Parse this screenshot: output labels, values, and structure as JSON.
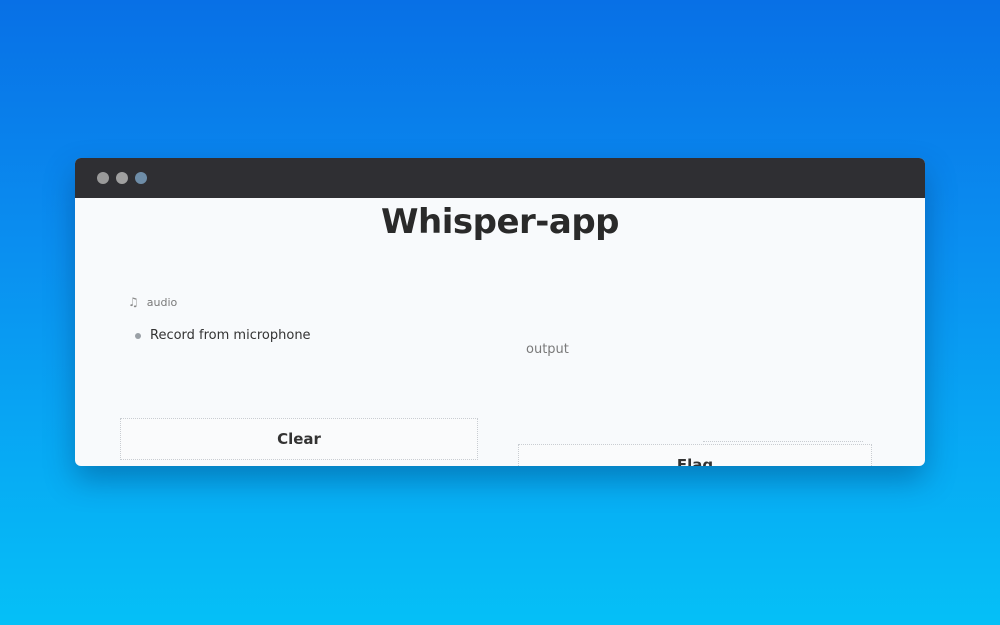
{
  "window": {
    "title": "Whisper-app"
  },
  "inputs": {
    "audio_label": "audio",
    "record_label": "Record from microphone"
  },
  "outputs": {
    "output_label": "output"
  },
  "buttons": {
    "clear_label": "Clear",
    "flag_label": "Flag"
  },
  "icons": {
    "audio": "music-note-icon"
  },
  "colors": {
    "background_top": "#0870e6",
    "background_bottom": "#05c0f7",
    "titlebar": "#2f2f33",
    "window": "#f8fafc"
  }
}
